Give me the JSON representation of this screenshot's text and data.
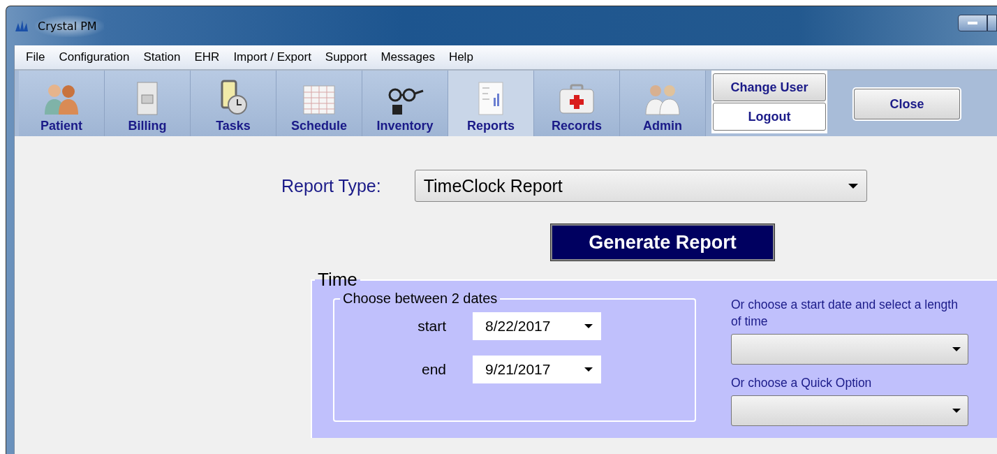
{
  "window": {
    "title": "Crystal PM"
  },
  "menu": [
    "File",
    "Configuration",
    "Station",
    "EHR",
    "Import / Export",
    "Support",
    "Messages",
    "Help"
  ],
  "toolbar": [
    {
      "label": "Patient",
      "selected": false
    },
    {
      "label": "Billing",
      "selected": false
    },
    {
      "label": "Tasks",
      "selected": false
    },
    {
      "label": "Schedule",
      "selected": false
    },
    {
      "label": "Inventory",
      "selected": false
    },
    {
      "label": "Reports",
      "selected": true
    },
    {
      "label": "Records",
      "selected": false
    },
    {
      "label": "Admin",
      "selected": false
    }
  ],
  "user_buttons": [
    {
      "label": "Change User",
      "focused": false
    },
    {
      "label": "Logout",
      "focused": true
    }
  ],
  "close_button": "Close",
  "report_type": {
    "label": "Report Type:",
    "value": "TimeClock Report"
  },
  "generate_button": "Generate Report",
  "time": {
    "title": "Time",
    "between": {
      "title": "Choose between 2 dates",
      "fields": [
        {
          "label": "start",
          "value": "8/22/2017"
        },
        {
          "label": "end",
          "value": "9/21/2017"
        }
      ]
    },
    "length_label": "Or choose a start date and select a length of time",
    "quick_label": "Or choose a Quick Option"
  }
}
